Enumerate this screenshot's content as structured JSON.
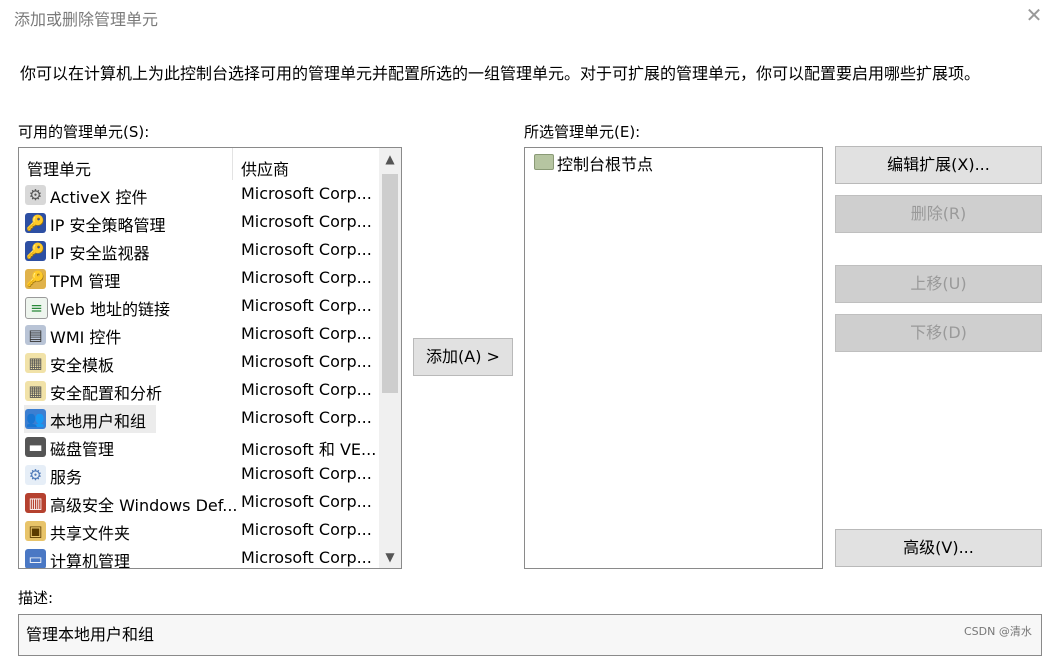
{
  "window": {
    "title": "添加或删除管理单元",
    "close_icon": "close-icon"
  },
  "intro_text": "你可以在计算机上为此控制台选择可用的管理单元并配置所选的一组管理单元。对于可扩展的管理单元，你可以配置要启用哪些扩展项。",
  "available": {
    "label": "可用的管理单元(S):",
    "columns": [
      "管理单元",
      "供应商"
    ],
    "items": [
      {
        "icon": "activex-icon",
        "name": "ActiveX 控件",
        "vendor": "Microsoft Corp..."
      },
      {
        "icon": "ip-security-policy-icon",
        "name": "IP 安全策略管理",
        "vendor": "Microsoft Corp..."
      },
      {
        "icon": "ip-security-monitor-icon",
        "name": "IP 安全监视器",
        "vendor": "Microsoft Corp..."
      },
      {
        "icon": "tpm-icon",
        "name": "TPM 管理",
        "vendor": "Microsoft Corp..."
      },
      {
        "icon": "web-link-icon",
        "name": "Web 地址的链接",
        "vendor": "Microsoft Corp..."
      },
      {
        "icon": "wmi-icon",
        "name": "WMI 控件",
        "vendor": "Microsoft Corp..."
      },
      {
        "icon": "security-template-icon",
        "name": "安全模板",
        "vendor": "Microsoft Corp..."
      },
      {
        "icon": "security-config-icon",
        "name": "安全配置和分析",
        "vendor": "Microsoft Corp..."
      },
      {
        "icon": "local-users-icon",
        "name": "本地用户和组",
        "vendor": "Microsoft Corp..."
      },
      {
        "icon": "disk-management-icon",
        "name": "磁盘管理",
        "vendor": "Microsoft 和 VE..."
      },
      {
        "icon": "services-icon",
        "name": "服务",
        "vendor": "Microsoft Corp..."
      },
      {
        "icon": "firewall-icon",
        "name": "高级安全 Windows Def...",
        "vendor": "Microsoft Corp..."
      },
      {
        "icon": "shared-folders-icon",
        "name": "共享文件夹",
        "vendor": "Microsoft Corp..."
      },
      {
        "icon": "computer-management-icon",
        "name": "计算机管理",
        "vendor": "Microsoft Corp..."
      }
    ],
    "selected_index": 8
  },
  "add_button": "添加(A) >",
  "selected": {
    "label": "所选管理单元(E):",
    "root": "控制台根节点"
  },
  "buttons": {
    "edit_ext": "编辑扩展(X)...",
    "remove": "删除(R)",
    "move_up": "上移(U)",
    "move_down": "下移(D)",
    "advanced": "高级(V)..."
  },
  "description": {
    "label": "描述:",
    "text": "管理本地用户和组"
  },
  "watermark": "CSDN @清水"
}
